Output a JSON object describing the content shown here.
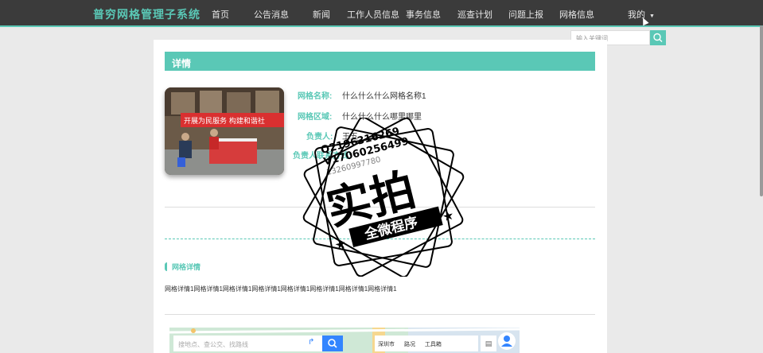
{
  "app": {
    "title": "普穷网格管理子系统"
  },
  "nav": {
    "items": [
      {
        "label": "首页"
      },
      {
        "label": "公告消息"
      },
      {
        "label": "新闻"
      },
      {
        "label": "工作人员信息"
      },
      {
        "label": "事务信息"
      },
      {
        "label": "巡查计划"
      },
      {
        "label": "问题上报"
      },
      {
        "label": "网格信息"
      }
    ],
    "user_menu": {
      "label": "我的"
    }
  },
  "search": {
    "placeholder": "输入关键词",
    "icon": "search-icon"
  },
  "detail": {
    "header": "详情",
    "photo": {
      "banner_text": "开展为民服务  构建和谐社"
    },
    "fields": [
      {
        "label": "网格名称:",
        "value": "什么什么什么网格名称1"
      },
      {
        "label": "网格区域:",
        "value": "什么什么什么哪里哪里"
      },
      {
        "label": "负责人:",
        "value": "王五"
      },
      {
        "label": "负责人联系方式:",
        "value": ""
      }
    ]
  },
  "grid_detail": {
    "title": "网格详情",
    "content": "网格详情1网格详情1网格详情1网格详情1网格详情1网格详情1网格详情1网格详情1"
  },
  "map": {
    "search_placeholder": "搜地点、查公交、找路线",
    "toolbar": [
      "深圳市",
      "路况",
      "工具箱"
    ]
  },
  "watermark": {
    "line1": "Q2196316269",
    "line2": "V17060256499",
    "line3": "13260997780",
    "main": "实拍",
    "sub": "全微程序"
  },
  "colors": {
    "accent": "#5ac8b6",
    "navbar": "#3b3b3b",
    "map_blue": "#3385ff"
  }
}
